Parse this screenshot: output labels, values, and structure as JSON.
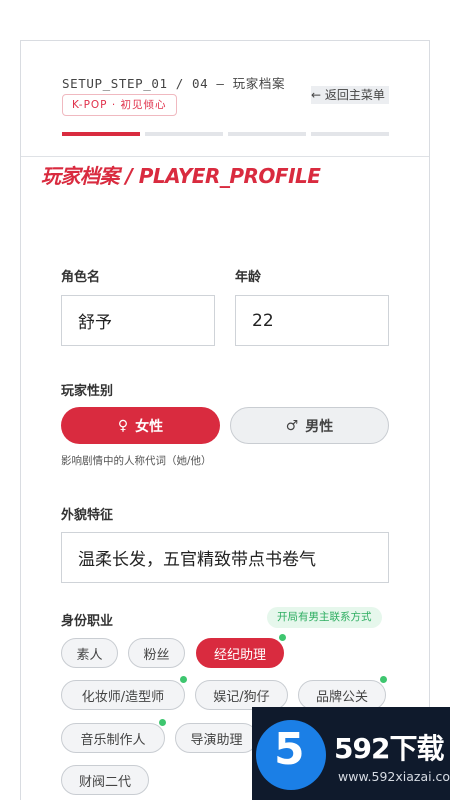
{
  "header": {
    "step_text": "SETUP_STEP_01 / 04 — 玩家档案",
    "back_label": "← 返回主菜单",
    "tag_text": "K-POP · 初见倾心",
    "progress": {
      "current": 1,
      "total": 4
    }
  },
  "form": {
    "title": "玩家档案 / PLAYER_PROFILE",
    "name_label": "角色名",
    "name_value": "舒予",
    "age_label": "年龄",
    "age_value": "22",
    "gender_label": "玩家性别",
    "female_icon": "♀",
    "female_label": "女性",
    "male_icon": "♂",
    "male_label": "男性",
    "gender_selected": "female",
    "gender_hint": "影响剧情中的人称代词（她/他）",
    "appearance_label": "外貌特征",
    "appearance_value": "温柔长发，五官精致带点书卷气",
    "job_label": "身份职业",
    "job_badge": "开局有男主联系方式",
    "jobs": [
      {
        "label": "素人",
        "selected": false,
        "marked": false
      },
      {
        "label": "粉丝",
        "selected": false,
        "marked": false
      },
      {
        "label": "经纪助理",
        "selected": true,
        "marked": true
      },
      {
        "label": "化妆师/造型师",
        "selected": false,
        "marked": true
      },
      {
        "label": "娱记/狗仔",
        "selected": false,
        "marked": false
      },
      {
        "label": "品牌公关",
        "selected": false,
        "marked": true
      },
      {
        "label": "音乐制作人",
        "selected": false,
        "marked": true
      },
      {
        "label": "导演助理",
        "selected": false,
        "marked": false
      },
      {
        "label": "财阀二代",
        "selected": false,
        "marked": false
      }
    ]
  },
  "watermark": {
    "logo_digit": "5",
    "brand": "592下载",
    "url": "www.592xiazai.com"
  },
  "colors": {
    "accent": "#d92b3f",
    "marker_green": "#3ec66f",
    "badge_bg": "#e6f7ec"
  }
}
